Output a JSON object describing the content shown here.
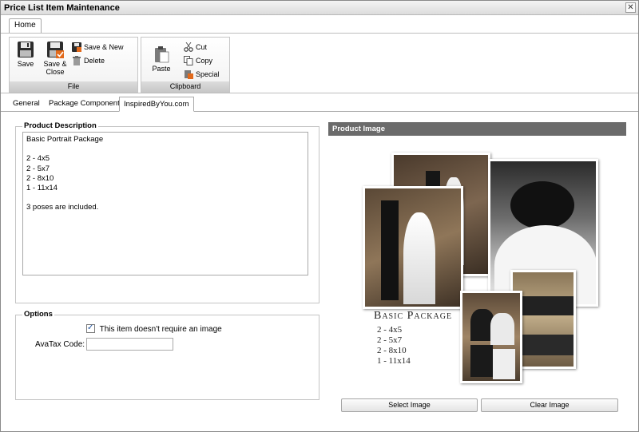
{
  "window": {
    "title": "Price List Item Maintenance",
    "close_glyph": "✕"
  },
  "ribbon": {
    "tab": "Home",
    "file_group": {
      "label": "File",
      "save": "Save",
      "save_close_line1": "Save &",
      "save_close_line2": "Close",
      "save_new": "Save & New",
      "delete": "Delete"
    },
    "clipboard_group": {
      "label": "Clipboard",
      "paste": "Paste",
      "cut": "Cut",
      "copy": "Copy",
      "special": "Special"
    }
  },
  "tabs": [
    "General",
    "Package Components",
    "InspiredByYou.com"
  ],
  "product_description": {
    "legend": "Product Description",
    "text": "Basic Portrait Package\n\n2 - 4x5\n2 - 5x7\n2 - 8x10\n1 - 11x14\n\n3 poses are included."
  },
  "options": {
    "legend": "Options",
    "no_image_label": "This item doesn't require an image",
    "no_image_checked": true,
    "avatax_label": "AvaTax Code:",
    "avatax_value": ""
  },
  "product_image": {
    "header": "Product Image",
    "package_title": "Basic Package",
    "package_lines": [
      "2 - 4x5",
      "2 - 5x7",
      "2 - 8x10",
      "1 - 11x14"
    ],
    "select_button": "Select Image",
    "clear_button": "Clear Image"
  }
}
